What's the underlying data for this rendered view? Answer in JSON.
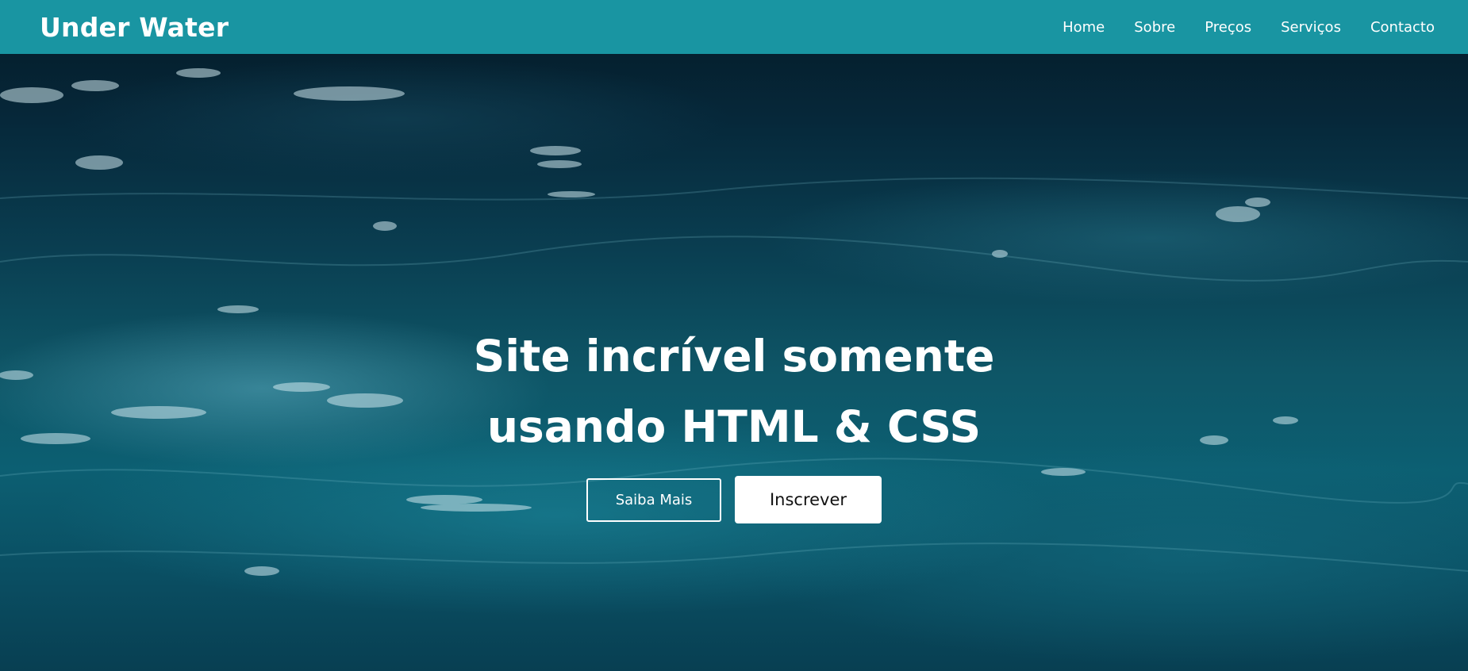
{
  "navbar": {
    "logo": "Under Water",
    "links": [
      "Home",
      "Sobre",
      "Preços",
      "Serviços",
      "Contacto"
    ]
  },
  "hero": {
    "title_line1": "Site incrível somente",
    "title_line2": "usando HTML & CSS",
    "primary_button": "Saiba Mais",
    "secondary_button": "Inscrever"
  },
  "colors": {
    "navbar_bg": "#1995a2",
    "text": "#ffffff",
    "water_dark": "#041a26",
    "water_light": "#0e5566"
  }
}
